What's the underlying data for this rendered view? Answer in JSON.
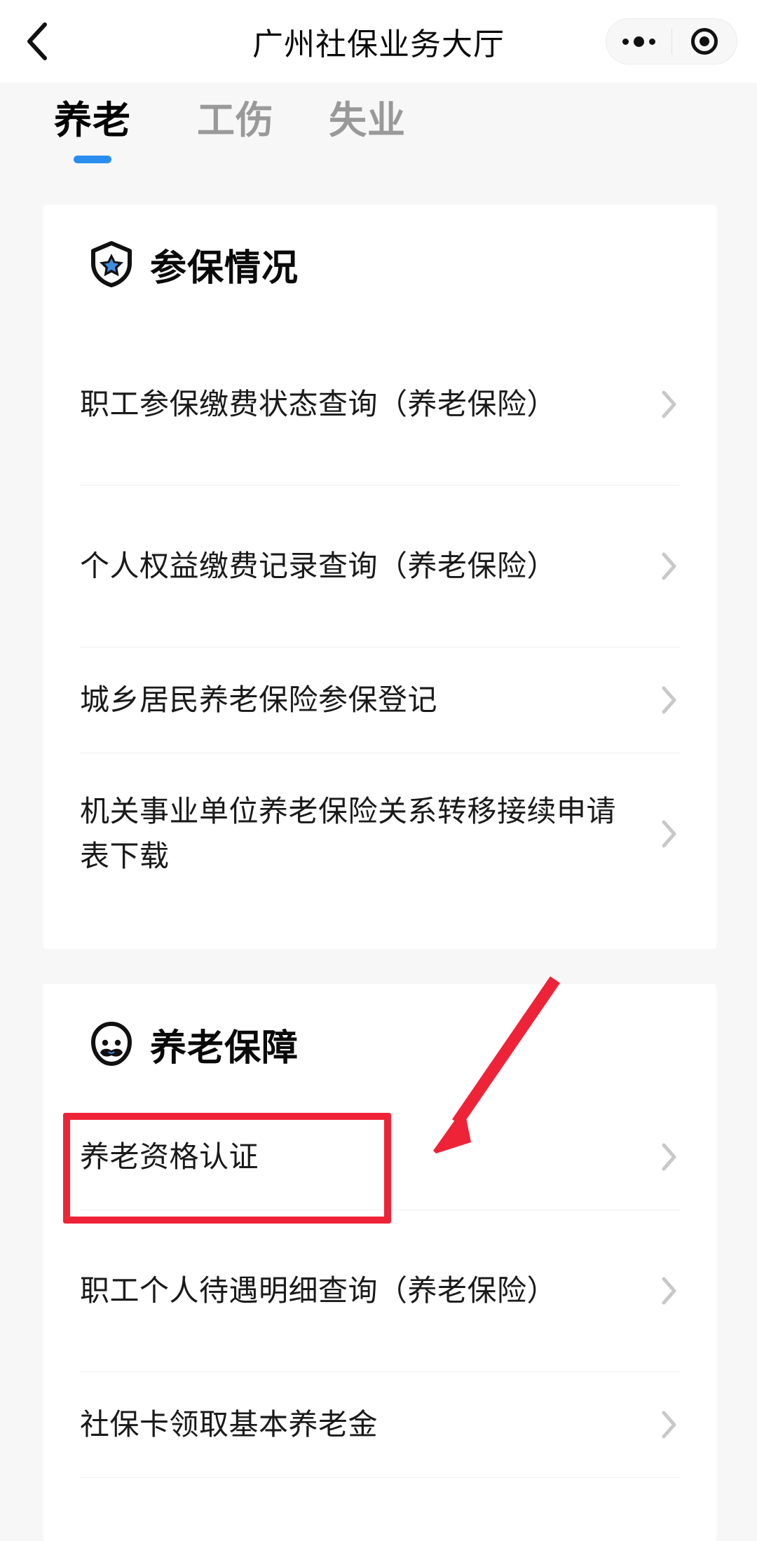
{
  "navbar": {
    "back_icon": "chevron-left-icon",
    "title": "广州社保业务大厅",
    "capsule": {
      "more_icon": "ellipsis-icon",
      "target_icon": "target-circle-icon"
    }
  },
  "tabs": [
    {
      "label": "养老",
      "active": true
    },
    {
      "label": "工伤",
      "active": false
    },
    {
      "label": "失业",
      "active": false
    }
  ],
  "sections": [
    {
      "icon": "shield-star-icon",
      "title": "参保情况",
      "items": [
        {
          "label": "职工参保缴费状态查询（养老保险）",
          "chevron": "chevron-right-icon"
        },
        {
          "label": "个人权益缴费记录查询（养老保险）",
          "chevron": "chevron-right-icon"
        },
        {
          "label": "城乡居民养老保险参保登记",
          "chevron": "chevron-right-icon"
        },
        {
          "label": "机关事业单位养老保险关系转移接续申请表下载",
          "chevron": "chevron-right-icon"
        }
      ]
    },
    {
      "icon": "elderly-face-icon",
      "title": "养老保障",
      "items": [
        {
          "label": "养老资格认证",
          "chevron": "chevron-right-icon",
          "highlighted": true
        },
        {
          "label": "职工个人待遇明细查询（养老保险）",
          "chevron": "chevron-right-icon"
        },
        {
          "label": "社保卡领取基本养老金",
          "chevron": "chevron-right-icon"
        }
      ]
    }
  ],
  "annotations": {
    "highlight_box": {
      "target": "养老资格认证",
      "color": "#ee2338"
    },
    "arrow": {
      "color": "#ee2338",
      "points_to": "养老资格认证"
    }
  },
  "colors": {
    "page_background": "#f7f7f7",
    "card_background": "#ffffff",
    "accent_blue": "#2a8ef0",
    "text_primary": "#1a1a1a",
    "text_muted": "#999999",
    "annotation_red": "#ee2338",
    "divider": "#f0f0f0"
  }
}
